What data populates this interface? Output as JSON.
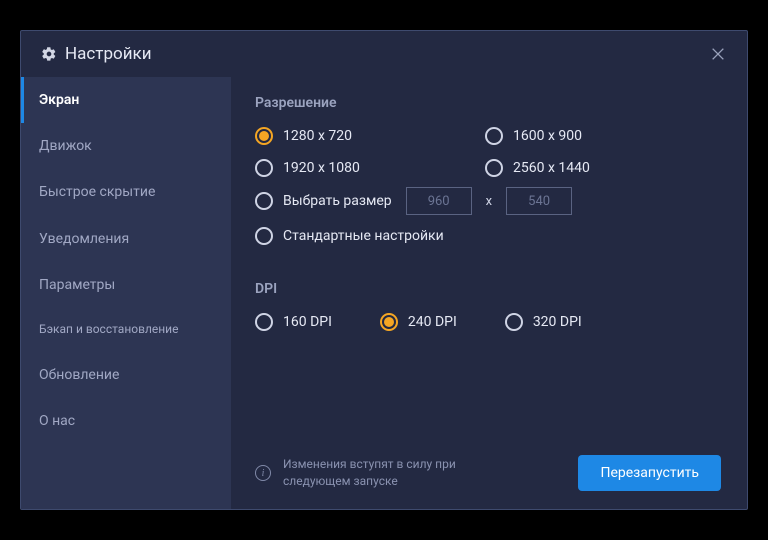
{
  "header": {
    "title": "Настройки"
  },
  "sidebar": {
    "items": [
      {
        "label": "Экран",
        "active": true
      },
      {
        "label": "Движок"
      },
      {
        "label": "Быстрое скрытие"
      },
      {
        "label": "Уведомления"
      },
      {
        "label": "Параметры"
      },
      {
        "label": "Бэкап и восстановление",
        "small": true
      },
      {
        "label": "Обновление"
      },
      {
        "label": "О нас"
      }
    ]
  },
  "resolution": {
    "title": "Разрешение",
    "options": {
      "r1": "1280 x 720",
      "r2": "1600 x 900",
      "r3": "1920 x 1080",
      "r4": "2560 x 1440",
      "custom": "Выбрать размер",
      "default": "Стандартные настройки"
    },
    "custom_w": "960",
    "custom_h": "540",
    "x_sep": "x"
  },
  "dpi": {
    "title": "DPI",
    "options": {
      "d1": "160 DPI",
      "d2": "240 DPI",
      "d3": "320 DPI"
    }
  },
  "footer": {
    "note": "Изменения вступят в силу при следующем запуске",
    "restart": "Перезапустить"
  }
}
